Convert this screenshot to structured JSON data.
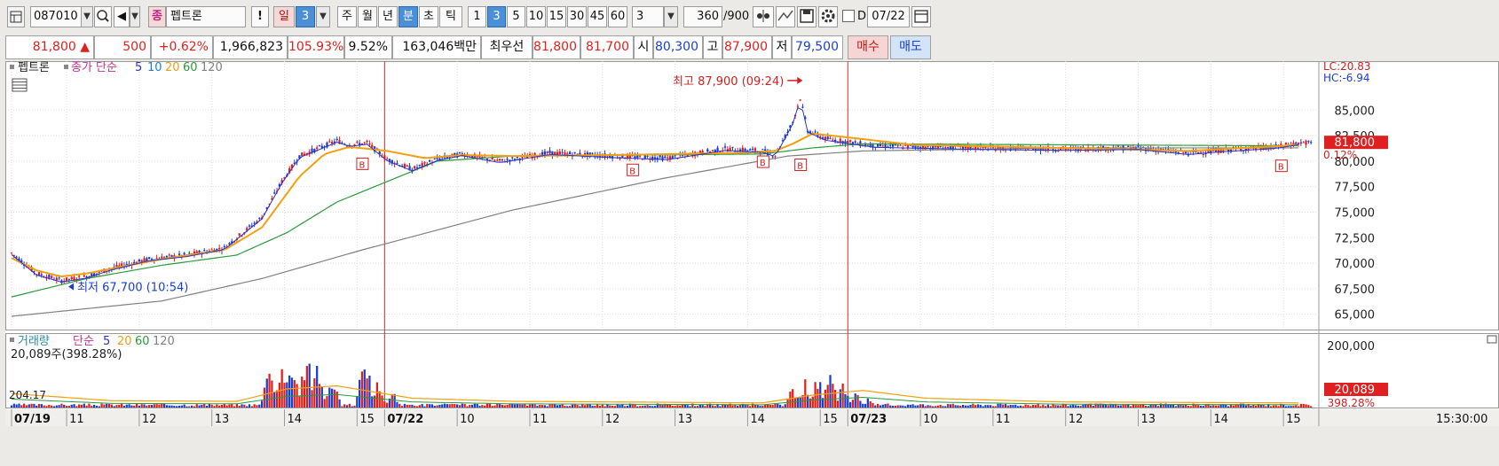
{
  "toolbar": {
    "code": "087010",
    "type_badge": "종",
    "name": "펩트론",
    "alert": "!",
    "period_unit": "일",
    "period_value": "3",
    "period_tabs": [
      "주",
      "월",
      "년",
      "분",
      "초",
      "틱"
    ],
    "active_tab": "분",
    "intervals": [
      "1",
      "3",
      "5",
      "10",
      "15",
      "30",
      "45",
      "60"
    ],
    "active_interval": "3",
    "custom_interval": "3",
    "count": "360",
    "count_total": "/900",
    "date_checkbox_label": "D",
    "date_value": "07/22"
  },
  "info": {
    "price": "81,800",
    "arrow": "▲",
    "change": "500",
    "change_pct": "+0.62%",
    "volume": "1,966,823",
    "vol_ratio": "105.93%",
    "turnover": "9.52%",
    "amount": "163,046백만",
    "best_label": "최우선",
    "best_ask": "81,800",
    "best_bid": "81,700",
    "open_label": "시",
    "open": "80,300",
    "high_label": "고",
    "high": "87,900",
    "low_label": "저",
    "low": "79,500",
    "buy_btn": "매수",
    "sell_btn": "매도"
  },
  "colors": {
    "up": "#e0201a",
    "down": "#1a3fd0",
    "ma5": "#3030c8",
    "ma10": "#1a7fd0",
    "ma20": "#f0a010",
    "ma60": "#2a9a3a",
    "ma120": "#808080"
  },
  "chart_data": [
    {
      "type": "line",
      "title": "펩트론",
      "legend": [
        "종가 단순",
        "5",
        "10",
        "20",
        "60",
        "120"
      ],
      "y_ticks": [
        85000,
        82500,
        80000,
        77500,
        75000,
        72500,
        70000,
        67500,
        65000
      ],
      "y_tick_labels": [
        "85,000",
        "82,500",
        "80,000",
        "77,500",
        "75,000",
        "72,500",
        "70,000",
        "67,500",
        "65,000"
      ],
      "ylim": [
        63500,
        89800
      ],
      "right_labels": {
        "lc": "LC:20.83",
        "hc": "HC:-6.94",
        "last_price": "81,800",
        "last_pct": "0.12%"
      },
      "annotations": {
        "high": "최고 87,900 (09:24)",
        "low": "최저 67,700 (10:54)"
      },
      "signal_marker": "B",
      "price_points": [
        [
          0,
          71000
        ],
        [
          10,
          69000
        ],
        [
          20,
          68300
        ],
        [
          30,
          68700
        ],
        [
          40,
          69500
        ],
        [
          55,
          70400
        ],
        [
          70,
          70800
        ],
        [
          85,
          71500
        ],
        [
          100,
          74500
        ],
        [
          108,
          78000
        ],
        [
          115,
          80500
        ],
        [
          125,
          81500
        ],
        [
          130,
          82000
        ],
        [
          135,
          81600
        ],
        [
          142,
          81800
        ],
        [
          150,
          80200
        ],
        [
          160,
          79200
        ],
        [
          170,
          80200
        ],
        [
          180,
          80700
        ],
        [
          195,
          80000
        ],
        [
          215,
          80800
        ],
        [
          240,
          80500
        ],
        [
          262,
          80300
        ],
        [
          285,
          81200
        ],
        [
          300,
          81000
        ],
        [
          305,
          80600
        ],
        [
          312,
          83800
        ],
        [
          315,
          86200
        ],
        [
          318,
          83000
        ],
        [
          325,
          82200
        ],
        [
          345,
          81500
        ],
        [
          385,
          81300
        ],
        [
          420,
          81200
        ],
        [
          450,
          81300
        ],
        [
          470,
          80800
        ],
        [
          485,
          81100
        ],
        [
          505,
          81400
        ],
        [
          515,
          81800
        ]
      ],
      "ma20_points": [
        [
          0,
          70500
        ],
        [
          10,
          69300
        ],
        [
          20,
          68700
        ],
        [
          30,
          69000
        ],
        [
          60,
          70400
        ],
        [
          85,
          71300
        ],
        [
          100,
          73500
        ],
        [
          115,
          78500
        ],
        [
          125,
          80700
        ],
        [
          135,
          81400
        ],
        [
          150,
          81000
        ],
        [
          165,
          80300
        ],
        [
          180,
          80600
        ],
        [
          200,
          80500
        ],
        [
          240,
          80600
        ],
        [
          290,
          80800
        ],
        [
          305,
          81000
        ],
        [
          312,
          81700
        ],
        [
          320,
          82700
        ],
        [
          335,
          82300
        ],
        [
          360,
          81600
        ],
        [
          420,
          81300
        ],
        [
          470,
          81000
        ],
        [
          515,
          81600
        ]
      ],
      "ma60_points": [
        [
          0,
          66700
        ],
        [
          30,
          68500
        ],
        [
          60,
          69800
        ],
        [
          90,
          70800
        ],
        [
          110,
          73000
        ],
        [
          130,
          76000
        ],
        [
          150,
          78000
        ],
        [
          170,
          80000
        ],
        [
          200,
          80500
        ],
        [
          300,
          80700
        ],
        [
          320,
          81300
        ],
        [
          340,
          81700
        ],
        [
          420,
          81600
        ],
        [
          515,
          81500
        ]
      ],
      "ma120_points": [
        [
          0,
          64800
        ],
        [
          60,
          66300
        ],
        [
          100,
          68500
        ],
        [
          140,
          71300
        ],
        [
          200,
          75200
        ],
        [
          260,
          78300
        ],
        [
          310,
          80500
        ],
        [
          340,
          81000
        ],
        [
          420,
          81300
        ],
        [
          515,
          81300
        ]
      ],
      "b_markers": [
        [
          140,
          79700
        ],
        [
          248,
          79100
        ],
        [
          300,
          79900
        ],
        [
          315,
          79600
        ],
        [
          507,
          79500
        ]
      ]
    },
    {
      "type": "bar",
      "title": "거래량",
      "legend": [
        "거래량",
        "단순",
        "5",
        "20",
        "60",
        "120"
      ],
      "current_label": "20,089주(398.28%)",
      "y_ticks": [
        200000
      ],
      "y_tick_labels": [
        "200,000"
      ],
      "left_tick_label": "204.17",
      "ylim": [
        0,
        240000
      ],
      "right_labels": {
        "last_volume": "20,089",
        "last_pct": "398.28%"
      },
      "volume_spikes": [
        [
          103,
          160000
        ],
        [
          108,
          185000
        ],
        [
          112,
          175000
        ],
        [
          118,
          210000
        ],
        [
          122,
          150000
        ],
        [
          128,
          110000
        ],
        [
          141,
          210000
        ],
        [
          146,
          85000
        ],
        [
          152,
          60000
        ],
        [
          312,
          70000
        ],
        [
          317,
          95000
        ],
        [
          322,
          110000
        ],
        [
          327,
          120000
        ],
        [
          332,
          80000
        ],
        [
          337,
          55000
        ],
        [
          342,
          30000
        ]
      ],
      "volume_ma20_points": [
        [
          0,
          45000
        ],
        [
          40,
          22000
        ],
        [
          90,
          20000
        ],
        [
          110,
          60000
        ],
        [
          130,
          70000
        ],
        [
          160,
          30000
        ],
        [
          200,
          20000
        ],
        [
          300,
          15000
        ],
        [
          320,
          40000
        ],
        [
          340,
          55000
        ],
        [
          365,
          30000
        ],
        [
          420,
          18000
        ],
        [
          515,
          15000
        ]
      ]
    }
  ],
  "time_axis": {
    "labels": [
      {
        "i": 0,
        "t": "07/19",
        "date": true
      },
      {
        "i": 22,
        "t": "11"
      },
      {
        "i": 51,
        "t": "12"
      },
      {
        "i": 80,
        "t": "13"
      },
      {
        "i": 109,
        "t": "14"
      },
      {
        "i": 138,
        "t": "15"
      },
      {
        "i": 149,
        "t": "07/22",
        "date": true
      },
      {
        "i": 178,
        "t": "10"
      },
      {
        "i": 207,
        "t": "11"
      },
      {
        "i": 236,
        "t": "12"
      },
      {
        "i": 265,
        "t": "13"
      },
      {
        "i": 294,
        "t": "14"
      },
      {
        "i": 323,
        "t": "15"
      },
      {
        "i": 334,
        "t": "07/23",
        "date": true
      },
      {
        "i": 363,
        "t": "10"
      },
      {
        "i": 392,
        "t": "11"
      },
      {
        "i": 421,
        "t": "12"
      },
      {
        "i": 450,
        "t": "13"
      },
      {
        "i": 479,
        "t": "14"
      },
      {
        "i": 508,
        "t": "15"
      }
    ],
    "end_time": "15:30:00",
    "day_separators": [
      149,
      334
    ]
  }
}
